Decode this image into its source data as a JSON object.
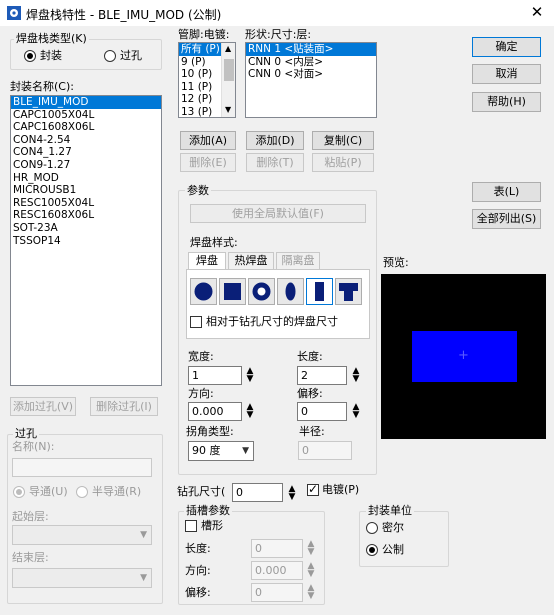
{
  "title": "焊盘栈特性 - BLE_IMU_MOD (公制)",
  "close_glyph": "✕",
  "stack_type": {
    "label": "焊盘栈类型(K)",
    "options": [
      "封装",
      "过孔"
    ],
    "selected": "封装"
  },
  "footprint_name": {
    "label": "封装名称(C):",
    "items": [
      "BLE_IMU_MOD",
      "CAPC1005X04L",
      "CAPC1608X06L",
      "CON4-2.54",
      "CON4_1.27",
      "CON9-1.27",
      "HR_MOD",
      "MICROUSB1",
      "RESC1005X04L",
      "RESC1608X06L",
      "SOT-23A",
      "TSSOP14"
    ],
    "selected_index": 0
  },
  "via_buttons": {
    "add": "添加过孔(V)",
    "delete": "删除过孔(I)"
  },
  "via_group": {
    "title": "过孔",
    "name_label": "名称(N):",
    "plating_options": [
      "导通(U)",
      "半导通(R)"
    ],
    "start_layer_label": "起始层:",
    "end_layer_label": "结束层:"
  },
  "pins": {
    "label": "管脚:电镀:",
    "items": [
      "所有 (P)",
      "9 (P)",
      "10 (P)",
      "11 (P)",
      "12 (P)",
      "13 (P)"
    ],
    "selected_index": 0,
    "add": "添加(A)",
    "delete": "删除(E)"
  },
  "shapes": {
    "label": "形状:尺寸:层:",
    "items": [
      "RNN 1 <贴装面>",
      "CNN 0 <内层>",
      "CNN 0 <对面>"
    ],
    "selected_index": 0,
    "add": "添加(D)",
    "copy": "复制(C)",
    "delete": "删除(T)",
    "paste": "粘贴(P)"
  },
  "params": {
    "title": "参数",
    "use_global": "使用全局默认值(F)",
    "pad_style_label": "焊盘样式:",
    "tabs": [
      "焊盘",
      "热焊盘",
      "隔离盘"
    ],
    "relative_drill_label": "相对于钻孔尺寸的焊盘尺寸",
    "width_label": "宽度:",
    "width_value": "1",
    "length_label": "长度:",
    "length_value": "2",
    "direction_label": "方向:",
    "direction_value": "0.000",
    "offset_label": "偏移:",
    "offset_value": "0",
    "corner_type_label": "拐角类型:",
    "corner_type_value": "90 度",
    "radius_label": "半径:",
    "radius_value": "0"
  },
  "drill": {
    "label": "钻孔尺寸(",
    "value": "0",
    "plated_label": "电镀(P)"
  },
  "slot": {
    "title": "插槽参数",
    "slotted_label": "槽形",
    "length_label": "长度:",
    "length_value": "0",
    "direction_label": "方向:",
    "direction_value": "0.000",
    "offset_label": "偏移:",
    "offset_value": "0"
  },
  "units": {
    "title": "封装单位",
    "options": [
      "密尔",
      "公制"
    ],
    "selected": "公制"
  },
  "buttons": {
    "ok": "确定",
    "cancel": "取消",
    "help": "帮助(H)",
    "table": "表(L)",
    "list_all": "全部列出(S)"
  },
  "preview_label": "预览:",
  "colors": {
    "preview_bg": "#000000",
    "pad": "#0000ff",
    "selection": "#0078d7"
  }
}
